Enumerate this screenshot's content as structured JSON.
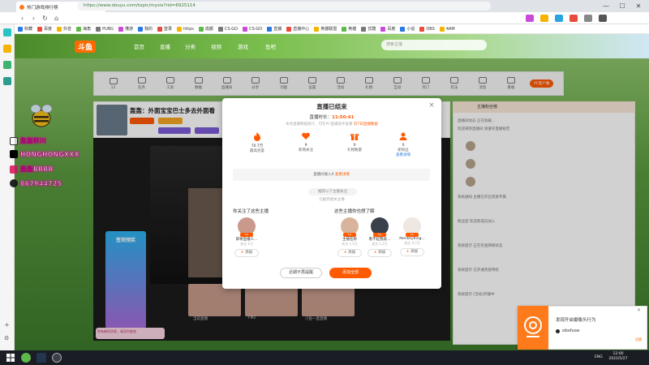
{
  "browser": {
    "tab_title": "热门游戏排行榜",
    "url": "https://www.douyu.com/topic/mysix?rid=6925114",
    "bookmarks": [
      "收藏",
      "百度",
      "抖音",
      "海角",
      "PUBG",
      "懂游",
      "我的",
      "登录",
      "https",
      "成都",
      "CS:GO",
      "CS:GO",
      "直播",
      "直播中心",
      "英雄联盟",
      "英雄",
      "优酷",
      "百度",
      "小说",
      "OBS",
      "4AM"
    ]
  },
  "site": {
    "logo": "斗鱼",
    "nav": [
      "首页",
      "直播",
      "分类",
      "视频",
      "游戏",
      "鱼吧"
    ],
    "search_placeholder": "搜索主播",
    "toolbar_items": [
      "12",
      "任务",
      "工具",
      "数据",
      "直播间",
      "分享",
      "功能",
      "设置",
      "活动",
      "礼物",
      "互动",
      "热门",
      "玩法",
      "消息",
      "看板",
      "PC客户端"
    ],
    "stream_title": "轰轰：外面宝宝巴士多去外面看"
  },
  "overlay": {
    "lines": [
      "轰轰轩川",
      "HONGHONGXXX",
      "轰轰BBBB",
      "867944725"
    ]
  },
  "modal": {
    "title": "直播已结束",
    "duration_label": "直播时长：",
    "duration_value": "11:50:41",
    "summary": "本场直播数据统计，可在PC直播助手查看",
    "summary_link": "近7日直播数据",
    "stats": [
      {
        "value": "70.7万",
        "label": "最高热度"
      },
      {
        "value": "9",
        "label": "新增关注"
      },
      {
        "value": "0",
        "label": "礼物数量"
      },
      {
        "value": "0",
        "label": "新粉丝",
        "more": "查看详情"
      }
    ],
    "revenue_text": "直播间收入0 ",
    "revenue_link": "查看详情",
    "rec_pill": "推荐以下主播关注",
    "rec_note": "已推荐相关主播",
    "followed_heading": "你关注了这些主播",
    "also_heading": "这些主播你也想了解",
    "followed": [
      {
        "name": "即将直播人...",
        "sub": "关注 1万"
      }
    ],
    "also": [
      {
        "name": "主播名称",
        "sub": "关注 1.5万"
      },
      {
        "name": "看不起我就...",
        "sub": "关注 1.2万"
      },
      {
        "name": "MonkeyKing...",
        "sub": "关注 4.7万"
      }
    ],
    "add_label": "添加",
    "btn_nomore": "近期不再提醒",
    "btn_addall": "添加全部"
  },
  "notification": {
    "title": "发现开启摄像头行为",
    "item": "obsfuse",
    "settings": "设置"
  },
  "rightpanel": {
    "header": "主播粉丝榜",
    "lines": [
      "直播间动态 正在加载...",
      "欢迎来到直播间 请遵守直播规范",
      "系统通知 主播已开启贵族专属",
      "粉丝团 欢迎新成员加入",
      "系统提示 正在检查网络状态",
      "系统提示 已开通贵族特权",
      "系统提示 [活动]开播中"
    ]
  },
  "player": {
    "thumbs": [
      "当前直播",
      "FM1",
      "小鱼一直直播"
    ],
    "game_banner": "签到领奖",
    "pink_tip": "你有新的消息，请及时查收"
  },
  "taskbar": {
    "lang": "ENG",
    "time": "12:00",
    "date": "2022/5/27"
  }
}
